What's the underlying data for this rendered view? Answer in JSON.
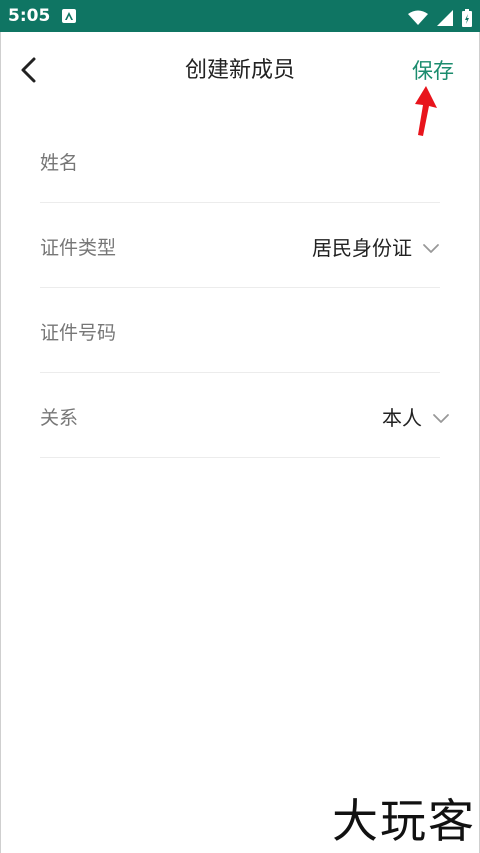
{
  "status_bar": {
    "time": "5:05"
  },
  "header": {
    "title": "创建新成员",
    "save_label": "保存"
  },
  "form": {
    "name_label": "姓名",
    "id_type_label": "证件类型",
    "id_type_value": "居民身份证",
    "id_number_label": "证件号码",
    "relation_label": "关系",
    "relation_value": "本人"
  },
  "watermark": "大玩客",
  "colors": {
    "status_bar": "#0f7563",
    "accent": "#1b8c6e",
    "arrow": "#e8141c"
  }
}
